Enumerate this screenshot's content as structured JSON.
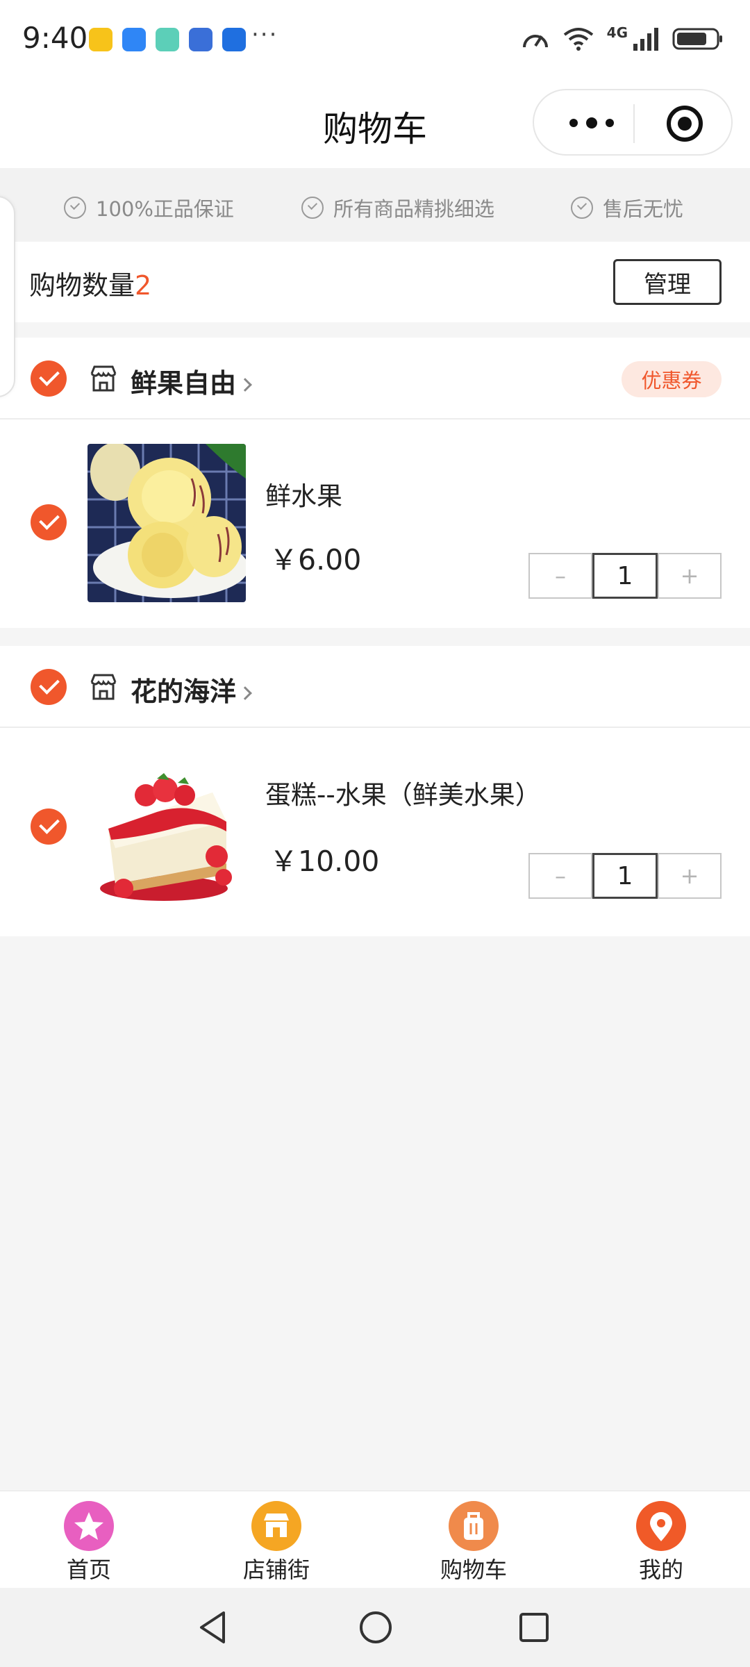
{
  "status_bar": {
    "time": "9:40",
    "dots": "···",
    "network": "4G"
  },
  "navbar": {
    "title": "购物车"
  },
  "guarantees": [
    {
      "label": "100%正品保证"
    },
    {
      "label": "所有商品精挑细选"
    },
    {
      "label": "售后无忧"
    }
  ],
  "cart": {
    "count_label": "购物数量",
    "count_value": "2",
    "manage_label": "管理"
  },
  "stores": [
    {
      "name": "鲜果自由",
      "coupon_label": "优惠券",
      "selected": true,
      "items": [
        {
          "name": "鲜水果",
          "price": "￥6.00",
          "quantity": "1",
          "minus": "–",
          "plus": "+",
          "selected": true
        }
      ]
    },
    {
      "name": "花的海洋",
      "selected": true,
      "items": [
        {
          "name": "蛋糕--水果（鲜美水果）",
          "price": "￥10.00",
          "quantity": "1",
          "minus": "–",
          "plus": "+",
          "selected": true
        }
      ]
    }
  ],
  "tabbar": [
    {
      "label": "首页",
      "icon": "star-icon",
      "color": "#e85fc0"
    },
    {
      "label": "店铺街",
      "icon": "storefront-icon",
      "color": "#f5a623"
    },
    {
      "label": "购物车",
      "icon": "bag-icon",
      "color": "#f08a4b"
    },
    {
      "label": "我的",
      "icon": "location-pin-icon",
      "color": "#f05a28"
    }
  ],
  "colors": {
    "accent": "#f0572c",
    "coupon_bg": "#fde8e0",
    "page_bg": "#f5f5f5"
  }
}
